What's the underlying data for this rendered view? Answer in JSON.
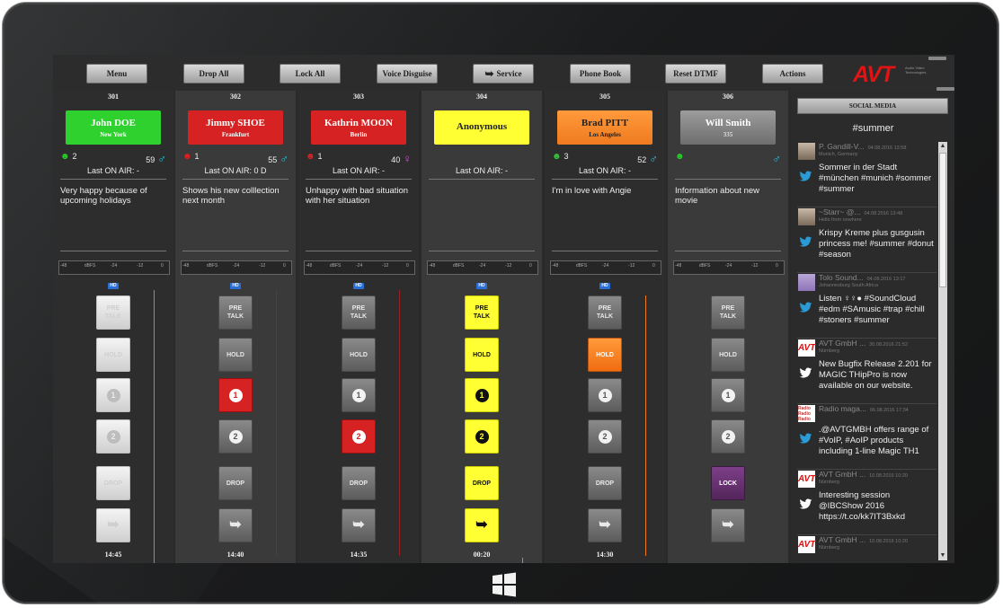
{
  "toolbar": {
    "menu": "Menu",
    "drop_all": "Drop All",
    "lock_all": "Lock All",
    "voice_disguise": "Voice Disguise",
    "service": "Service",
    "phone_book": "Phone Book",
    "reset_dtmf": "Reset DTMF",
    "actions": "Actions"
  },
  "logo": {
    "text": "AVT",
    "tagline": "Audio Video Technologies"
  },
  "lines": [
    {
      "id": "301",
      "name": "John DOE",
      "city": "New York",
      "count": "2",
      "age": "59",
      "gender": "♂",
      "last_on_air": "Last ON AIR: -",
      "comment": "Very happy because of upcoming holidays",
      "pretalk": "PRE TALK",
      "hold": "HOLD",
      "l1": "1",
      "l2": "2",
      "drop": "DROP",
      "time": "14:45",
      "hd": "HD"
    },
    {
      "id": "302",
      "name": "Jimmy SHOE",
      "city": "Frankfurt",
      "count": "1",
      "age": "55",
      "gender": "♂",
      "last_on_air": "Last ON AIR: 0 D",
      "comment": "Shows his new colllection next month",
      "pretalk": "PRE TALK",
      "hold": "HOLD",
      "l1": "1",
      "l2": "2",
      "drop": "DROP",
      "time": "14:40",
      "hd": "HD"
    },
    {
      "id": "303",
      "name": "Kathrin MOON",
      "city": "Berlin",
      "count": "1",
      "age": "40",
      "gender": "♀",
      "last_on_air": "Last ON AIR: -",
      "comment": "Unhappy with bad situation with her situation",
      "pretalk": "PRE TALK",
      "hold": "HOLD",
      "l1": "1",
      "l2": "2",
      "drop": "DROP",
      "time": "14:35",
      "hd": "HD"
    },
    {
      "id": "304",
      "name": "Anonymous",
      "city": "",
      "count": "",
      "age": "",
      "gender": "",
      "last_on_air": "Last ON AIR: -",
      "comment": "",
      "pretalk": "PRE TALK",
      "hold": "HOLD",
      "l1": "1",
      "l2": "2",
      "drop": "DROP",
      "time": "00:20",
      "hd": "HD"
    },
    {
      "id": "305",
      "name": "Brad PITT",
      "city": "Los Angeles",
      "count": "3",
      "age": "52",
      "gender": "♂",
      "last_on_air": "Last ON AIR: -",
      "comment": "I'm in love with Angie",
      "pretalk": "PRE TALK",
      "hold": "HOLD",
      "l1": "1",
      "l2": "2",
      "drop": "DROP",
      "time": "14:30",
      "hd": "HD"
    },
    {
      "id": "306",
      "name": "Will Smith",
      "city": "335",
      "count": "",
      "age": "",
      "gender": "♂",
      "last_on_air": "",
      "comment": "Information about new movie",
      "pretalk": "PRE TALK",
      "hold": "HOLD",
      "l1": "1",
      "l2": "2",
      "drop": "LOCK",
      "time": "",
      "hd": ""
    }
  ],
  "meter": {
    "ticks": [
      "-48",
      "dBFS",
      "-24",
      "-12",
      "0"
    ]
  },
  "social": {
    "header": "SOCIAL MEDIA",
    "hashtag": "#summer",
    "tweets": [
      {
        "user": "P. Gandill-V...",
        "date": "04.08.2016 13:58",
        "location": "Munich, Germany",
        "text": "Sommer in der Stadt #münchen #munich #sommer #summer",
        "avatar": "person"
      },
      {
        "user": "~Starr~ @...",
        "date": "04.08.2016 13:48",
        "location": "Hello from nowhere",
        "text": "Krispy Kreme plus gusgusin princess me! #summer #donut #season",
        "avatar": "person"
      },
      {
        "user": "Tolo Sound...",
        "date": "04.08.2016 13:17",
        "location": "Johannesburg South Africa",
        "text": "Listen ♀♀● #SoundCloud #edm #SAmusic #trap #chill #stoners #summer",
        "avatar": "purple"
      },
      {
        "user": "AVT GmbH ...",
        "date": "30.08.2016 21:52",
        "location": "Nürnberg",
        "text": "New Bugfix Release 2.201 for MAGIC THipPro is now available on our website.",
        "avatar": "avt"
      },
      {
        "user": "Radio maga...",
        "date": "06.08.2016 17:34",
        "location": "",
        "text": ".@AVTGMBH offers range of #VoIP, #AoIP products including 1-line Magic TH1",
        "avatar": "radio"
      },
      {
        "user": "AVT GmbH ...",
        "date": "10.08.2016 10:20",
        "location": "Nürnberg",
        "text": "Interesting session @IBCShow 2016 https://t.co/kk7IT3Bxkd",
        "avatar": "avt"
      },
      {
        "user": "AVT GmbH ...",
        "date": "10.08.2016 10:20",
        "location": "Nürnberg",
        "text": "",
        "avatar": "avt"
      }
    ]
  },
  "colors": {
    "green": "#2ecc2e",
    "red": "#d62222",
    "yellow": "#ffff33",
    "orange": "#f07a1f",
    "grey": "#8a8a8a",
    "accent_blue": "#2a9bd6",
    "male": "#2ec4e0",
    "female": "#d24ad8"
  },
  "icons": [
    "windows-logo-icon",
    "twitter-bird-icon",
    "male-icon",
    "female-icon",
    "smiley-icon",
    "forward-arrow-icon"
  ]
}
